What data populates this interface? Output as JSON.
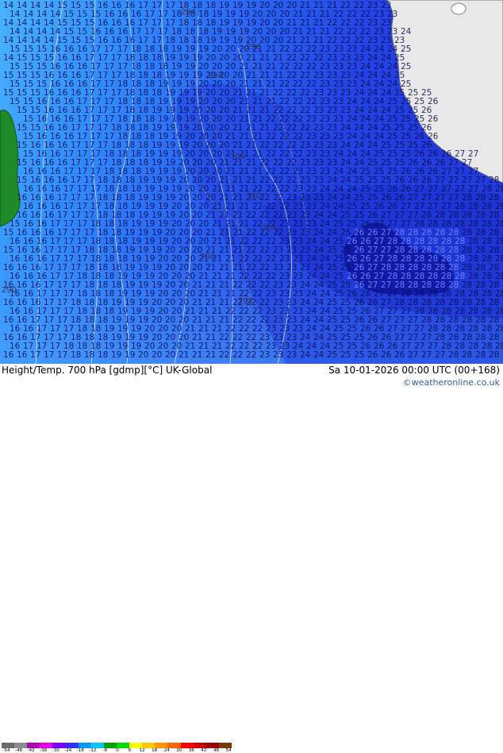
{
  "footer": {
    "left_title": "Height/Temp. 700 hPa [gdmp][°C] UK-Global",
    "right_date": "Sa 10-01-2026 00:00 UTC (00+168)",
    "credit": "©weatheronline.co.uk"
  },
  "colorbar": {
    "labels": [
      "-54",
      "-48",
      "-42",
      "-38",
      "-30",
      "-24",
      "-18",
      "-12",
      "-6",
      "0",
      "6",
      "12",
      "18",
      "24",
      "30",
      "36",
      "42",
      "48",
      "54"
    ],
    "colors": [
      "#6b6b6b",
      "#8c8c8c",
      "#b400b4",
      "#e600e6",
      "#7800ff",
      "#3232ff",
      "#0096ff",
      "#00c8ff",
      "#00a000",
      "#00dc00",
      "#ffff00",
      "#ffc800",
      "#ff9600",
      "#ff6400",
      "#ff0000",
      "#c80000",
      "#960000",
      "#7a3a00"
    ]
  },
  "map_labels": {
    "contour_values": [
      "14",
      "15",
      "16",
      "17",
      "18",
      "19",
      "20",
      "21",
      "22",
      "23",
      "24",
      "25",
      "26",
      "27",
      "28"
    ],
    "height_labels": [
      "290",
      "292",
      "294",
      "296",
      "298",
      "300",
      "302",
      "304",
      "306"
    ]
  },
  "colors": {
    "land_gray": "#e8e8e8",
    "land_green": "#1f8a2a",
    "ocean_light": "#3aa0ff",
    "ocean_dark": "#1b2fd6",
    "core_dark": "#0f1aa8"
  }
}
